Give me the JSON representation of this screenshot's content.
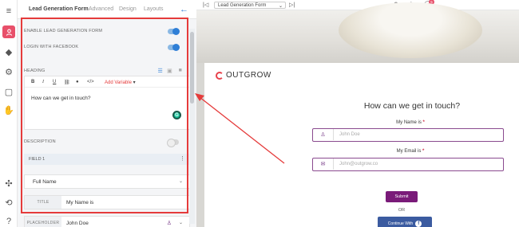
{
  "tabs": [
    "Lead Generation Form",
    "Advanced",
    "Design",
    "Layouts"
  ],
  "settings": {
    "enable_lead_gen": "ENABLE LEAD GENERATION FORM",
    "login_facebook": "LOGIN WITH FACEBOOK",
    "heading_label": "HEADING",
    "editor": {
      "bold": "B",
      "italic": "I",
      "underline": "U",
      "add_variable": "Add Variable",
      "text": "How can we get in touch?"
    },
    "description_label": "DESCRIPTION",
    "field1_label": "FIELD 1",
    "field_type": "Full Name",
    "title_key": "TITLE",
    "title_value": "My Name is",
    "placeholder_key": "PLACEHOLDER",
    "placeholder_value": "John Doe"
  },
  "topbar": {
    "page_select": "Lead Generation Form",
    "badge": "5"
  },
  "preview": {
    "logo": "OUTGROW",
    "title": "How can we get in touch?",
    "name_label": "My Name is",
    "required_mark": "*",
    "name_placeholder": "John Doe",
    "email_label": "My Email is",
    "email_placeholder": "John@outgrow.co",
    "submit": "Submit",
    "or": "OR",
    "facebook_btn": "Continue With"
  },
  "colors": {
    "accent_blue": "#2f7fd6",
    "highlight_red": "#e53b3b",
    "brand_purple": "#7a1b79",
    "facebook": "#3b5ba0"
  }
}
